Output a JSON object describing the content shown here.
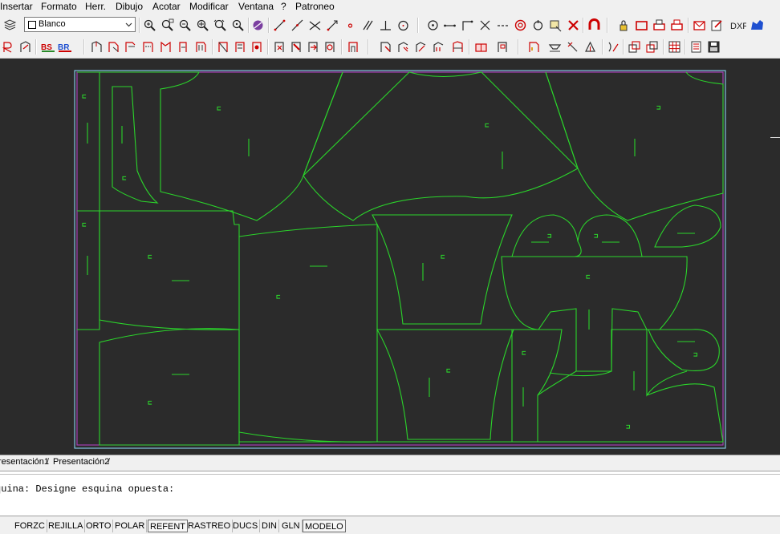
{
  "menu": {
    "items": [
      "Insertar",
      "Formato",
      "Herr.",
      "Dibujo",
      "Acotar",
      "Modificar",
      "Ventana",
      "?",
      "Patroneo"
    ]
  },
  "layer": {
    "current": "Blanco"
  },
  "drawing": {
    "background_color": "#2b2b2b",
    "line_color": "#2bd42b",
    "border_color": "#8ad0f0",
    "margin_color": "#b040c0"
  },
  "layout_tabs": [
    "resentación1",
    "Presentación2"
  ],
  "command": {
    "prompt": "quina: Designe esquina opuesta:"
  },
  "status": {
    "buttons": [
      {
        "label": "FORZC",
        "on": false
      },
      {
        "label": "REJILLA",
        "on": false
      },
      {
        "label": "ORTO",
        "on": false
      },
      {
        "label": "POLAR",
        "on": false
      },
      {
        "label": "REFENT",
        "on": true
      },
      {
        "label": "RASTREO",
        "on": false
      },
      {
        "label": "DUCS",
        "on": false
      },
      {
        "label": "DIN",
        "on": false
      },
      {
        "label": "GLN",
        "on": false
      },
      {
        "label": "MODELO",
        "on": true
      }
    ]
  },
  "toolbar_icons": {
    "row1": [
      "layers-icon",
      "zoom-realtime-icon",
      "zoom-window-icon",
      "zoom-previous-icon",
      "zoom-extents-icon",
      "zoom-all-icon",
      "render-icon",
      "line-icon",
      "construction-line-icon",
      "polyline-icon",
      "spline-icon",
      "point-icon",
      "parallel-icon",
      "perpendicular-icon",
      "circle-icon",
      "center-icon",
      "dimension-icon",
      "corner-icon",
      "intersection-icon",
      "dashed-line-icon",
      "target-icon",
      "rotate-icon",
      "move-icon",
      "delete-icon",
      "magnet-icon",
      "lock-icon",
      "rectangle-icon",
      "print-icon",
      "plot-icon",
      "mail-icon",
      "export-icon",
      "dxf-icon",
      "piece-icon"
    ],
    "row2": [
      "pattern-icon",
      "copy-pattern-icon",
      "grade-icon",
      "brand-icon",
      "piece-create-icon",
      "piece-mirror-icon",
      "piece-offset-icon",
      "seam-icon",
      "notch-icon",
      "dart-icon",
      "pleat-icon",
      "fold-icon",
      "grading-icon",
      "measure-icon",
      "piece-info-icon",
      "marker-icon",
      "nest-icon",
      "hatch-icon",
      "grainline-icon",
      "label-icon",
      "cut-icon",
      "plot-marker-icon",
      "save-icon"
    ]
  }
}
